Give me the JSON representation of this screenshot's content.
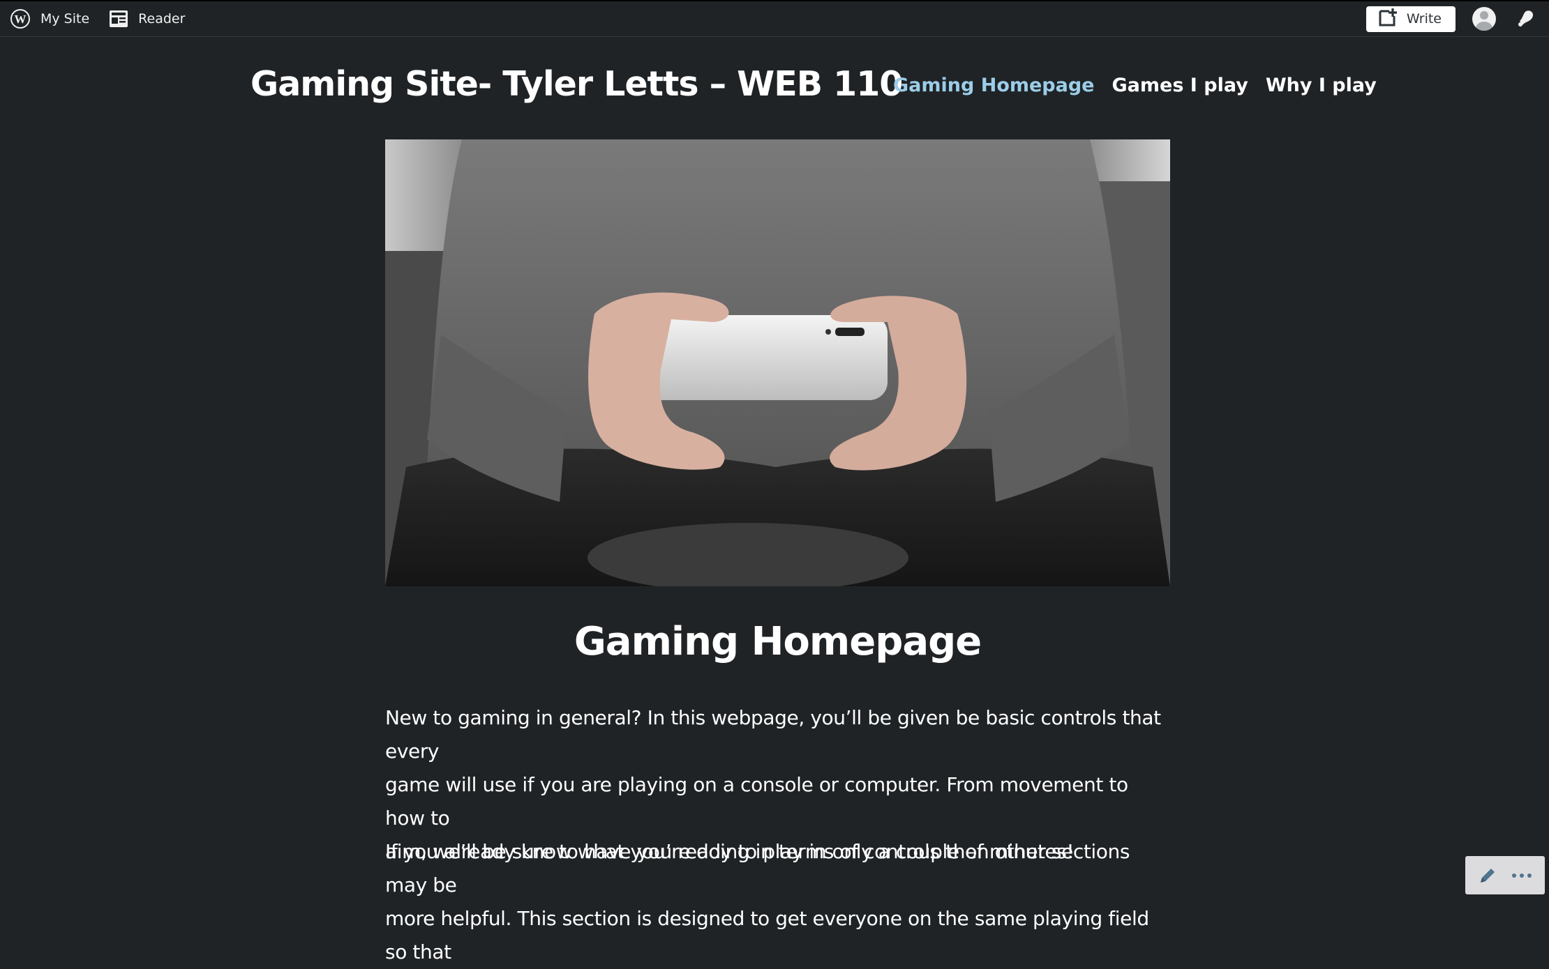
{
  "admin_bar": {
    "my_site_label": "My Site",
    "reader_label": "Reader",
    "write_label": "Write"
  },
  "site": {
    "title": "Gaming Site- Tyler Letts – WEB 110"
  },
  "nav": {
    "items": [
      {
        "label": "Gaming Homepage",
        "current": true
      },
      {
        "label": "Games I play",
        "current": false
      },
      {
        "label": "Why I play",
        "current": false
      }
    ]
  },
  "page": {
    "title": "Gaming Homepage",
    "paragraph_1_lines": [
      "New to gaming in general? In this webpage, you’ll be given be basic controls that every",
      "game will use if you are playing on a console or computer. From movement to how to",
      "aim, we’ll be sure to have you ready to play in only a couple of minutes!"
    ],
    "paragraph_2_lines": [
      "If you already know what you’re doing in terms of controls then other sections may be",
      "more helpful. This section is designed to get everyone on the same playing field so that"
    ]
  },
  "colors": {
    "background": "#1f2326",
    "nav_current": "#9ccde8",
    "text": "#ffffff"
  },
  "icons": {
    "logo": "wordpress-icon",
    "reader": "reader-icon",
    "write": "write-plus-icon",
    "avatar": "avatar-icon",
    "notifications": "bell-icon",
    "edit": "pencil-icon",
    "more": "ellipsis-icon"
  }
}
